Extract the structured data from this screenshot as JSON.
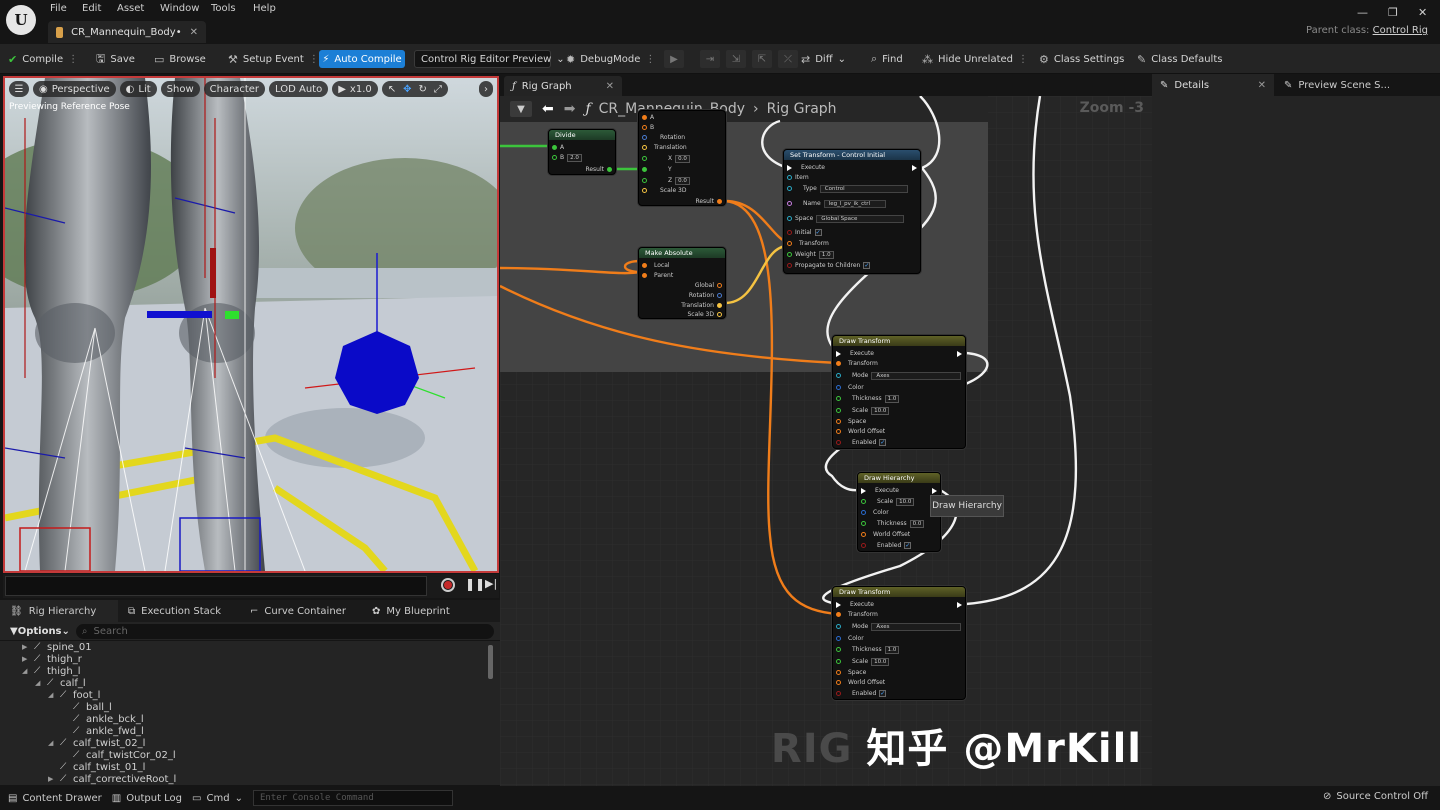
{
  "menu": [
    "File",
    "Edit",
    "Asset",
    "Window",
    "Tools",
    "Help"
  ],
  "document_tab": "CR_Mannequin_Body•",
  "parent_class_label": "Parent class:",
  "parent_class_value": "Control Rig",
  "toolbar": {
    "compile": "Compile",
    "save": "Save",
    "browse": "Browse",
    "setup_event": "Setup Event",
    "auto_compile": "Auto Compile",
    "preview": "Control Rig Editor Preview",
    "debug_mode": "DebugMode",
    "diff": "Diff",
    "find": "Find",
    "hide_unrelated": "Hide Unrelated",
    "class_settings": "Class Settings",
    "class_defaults": "Class Defaults"
  },
  "viewport": {
    "perspective": "Perspective",
    "lit": "Lit",
    "show": "Show",
    "character": "Character",
    "lod": "LOD Auto",
    "speed": "x1.0",
    "status": "Previewing Reference Pose"
  },
  "panel_tabs": [
    "Rig Hierarchy",
    "Execution Stack",
    "Curve Container",
    "My Blueprint"
  ],
  "hierarchy": {
    "options": "Options",
    "search_placeholder": "Search",
    "items": [
      {
        "label": "spine_01",
        "depth": 0,
        "arrow": "▶"
      },
      {
        "label": "thigh_r",
        "depth": 0,
        "arrow": "▶"
      },
      {
        "label": "thigh_l",
        "depth": 0,
        "arrow": "◢"
      },
      {
        "label": "calf_l",
        "depth": 1,
        "arrow": "◢"
      },
      {
        "label": "foot_l",
        "depth": 2,
        "arrow": "◢"
      },
      {
        "label": "ball_l",
        "depth": 3,
        "arrow": ""
      },
      {
        "label": "ankle_bck_l",
        "depth": 3,
        "arrow": ""
      },
      {
        "label": "ankle_fwd_l",
        "depth": 3,
        "arrow": ""
      },
      {
        "label": "calf_twist_02_l",
        "depth": 2,
        "arrow": "◢"
      },
      {
        "label": "calf_twistCor_02_l",
        "depth": 3,
        "arrow": ""
      },
      {
        "label": "calf_twist_01_l",
        "depth": 2,
        "arrow": ""
      },
      {
        "label": "calf_correctiveRoot_l",
        "depth": 2,
        "arrow": "▶"
      }
    ]
  },
  "graph": {
    "tab": "Rig Graph",
    "breadcrumb_root": "CR_Mannequin_Body",
    "breadcrumb_leaf": "Rig Graph",
    "zoom": "Zoom -3",
    "tooltip": "Draw Hierarchy",
    "nodes": {
      "divide": {
        "title": "Divide",
        "a": "A",
        "b": "B",
        "b_val": "2.0",
        "result": "Result"
      },
      "vector": {
        "a": "A",
        "b": "B",
        "rotation": "Rotation",
        "translation": "Translation",
        "x": "X",
        "x_val": "0.0",
        "y": "Y",
        "z": "Z",
        "z_val": "0.0",
        "scale": "Scale 3D",
        "result": "Result"
      },
      "make_absolute": {
        "title": "Make Absolute",
        "local": "Local",
        "parent": "Parent",
        "global": "Global",
        "rotation": "Rotation",
        "translation": "Translation",
        "scale": "Scale 3D"
      },
      "set_transform": {
        "title": "Set Transform - Control Initial",
        "execute": "Execute",
        "item": "Item",
        "type": "Type",
        "type_val": "Control",
        "name": "Name",
        "name_val": "leg_l_pv_ik_ctrl",
        "space": "Space",
        "space_val": "Global Space",
        "initial": "Initial",
        "transform": "Transform",
        "weight": "Weight",
        "weight_val": "1.0",
        "propagate": "Propagate to Children"
      },
      "draw_transform_1": {
        "title": "Draw Transform",
        "execute": "Execute",
        "transform": "Transform",
        "mode": "Mode",
        "mode_val": "Axes",
        "color": "Color",
        "thickness": "Thickness",
        "thickness_val": "1.0",
        "scale": "Scale",
        "scale_val": "10.0",
        "space": "Space",
        "world_offset": "World Offset",
        "enabled": "Enabled"
      },
      "draw_hierarchy": {
        "title": "Draw Hierarchy",
        "execute": "Execute",
        "scale": "Scale",
        "scale_val": "10.0",
        "color": "Color",
        "thickness": "Thickness",
        "thickness_val": "0.0",
        "world_offset": "World Offset",
        "enabled": "Enabled"
      },
      "draw_transform_2": {
        "title": "Draw Transform",
        "execute": "Execute",
        "transform": "Transform",
        "mode": "Mode",
        "mode_val": "Axes",
        "color": "Color",
        "thickness": "Thickness",
        "thickness_val": "1.0",
        "scale": "Scale",
        "scale_val": "10.0",
        "space": "Space",
        "world_offset": "World Offset",
        "enabled": "Enabled"
      }
    }
  },
  "details": {
    "tab1": "Details",
    "tab2": "Preview Scene S..."
  },
  "bottom": {
    "content_drawer": "Content Drawer",
    "output_log": "Output Log",
    "cmd": "Cmd",
    "console_placeholder": "Enter Console Command",
    "source_control": "Source Control Off"
  },
  "watermark": {
    "rig": "RIG",
    "text": "知乎 @MrKill"
  },
  "colors": {
    "accent": "#1c7fd6",
    "exec": "#ffffff",
    "transform_pin": "#f07d1a",
    "vector_pin": "#f5c342",
    "float_pin": "#3cc43c",
    "bool_pin": "#9a1a1a",
    "name_pin": "#c77de0"
  }
}
